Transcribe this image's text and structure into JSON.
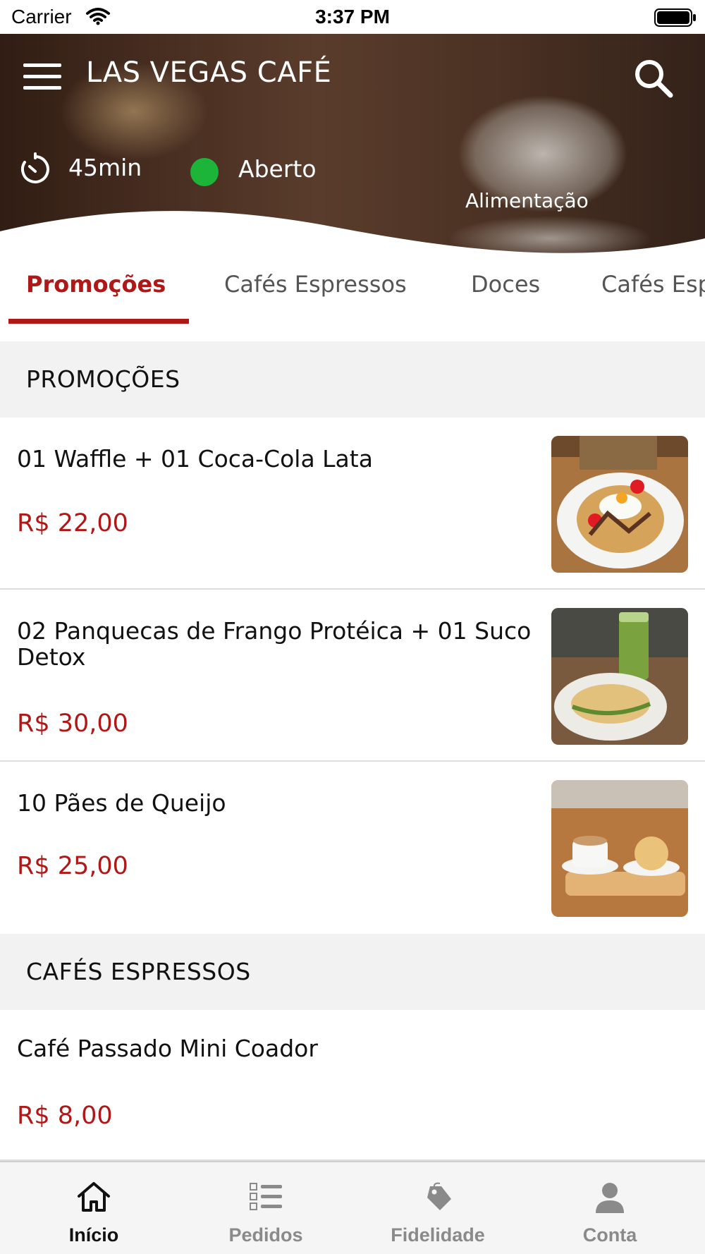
{
  "status_bar": {
    "carrier": "Carrier",
    "time": "3:37 PM"
  },
  "header": {
    "title": "LAS VEGAS CAFÉ",
    "delivery_time": "45min",
    "open_status": "Aberto",
    "category": "Alimentação",
    "open_color": "#1db43a"
  },
  "tabs": [
    {
      "label": "Promoções",
      "active": true
    },
    {
      "label": "Cafés Espressos",
      "active": false
    },
    {
      "label": "Doces",
      "active": false
    },
    {
      "label": "Cafés Especiais",
      "active": false
    }
  ],
  "sections": [
    {
      "title": "PROMOÇÕES",
      "items": [
        {
          "name": "01 Waffle + 01 Coca-Cola Lata",
          "price": "R$ 22,00",
          "image": "waffle-photo"
        },
        {
          "name": "02 Panquecas de Frango Protéica + 01 Suco Detox",
          "price": "R$ 30,00",
          "image": "pancake-juice-photo"
        },
        {
          "name": "10 Pães de Queijo",
          "price": "R$ 25,00",
          "image": "cheese-bread-coffee-photo"
        }
      ]
    },
    {
      "title": "CAFÉS ESPRESSOS",
      "items": [
        {
          "name": "Café Passado Mini Coador",
          "price": "R$ 8,00"
        }
      ]
    }
  ],
  "bottom_nav": [
    {
      "label": "Início",
      "icon": "home-icon",
      "active": true
    },
    {
      "label": "Pedidos",
      "icon": "orders-list-icon",
      "active": false
    },
    {
      "label": "Fidelidade",
      "icon": "loyalty-tag-icon",
      "active": false
    },
    {
      "label": "Conta",
      "icon": "account-icon",
      "active": false
    }
  ],
  "colors": {
    "accent": "#b01818",
    "section_bg": "#f2f2f2"
  }
}
